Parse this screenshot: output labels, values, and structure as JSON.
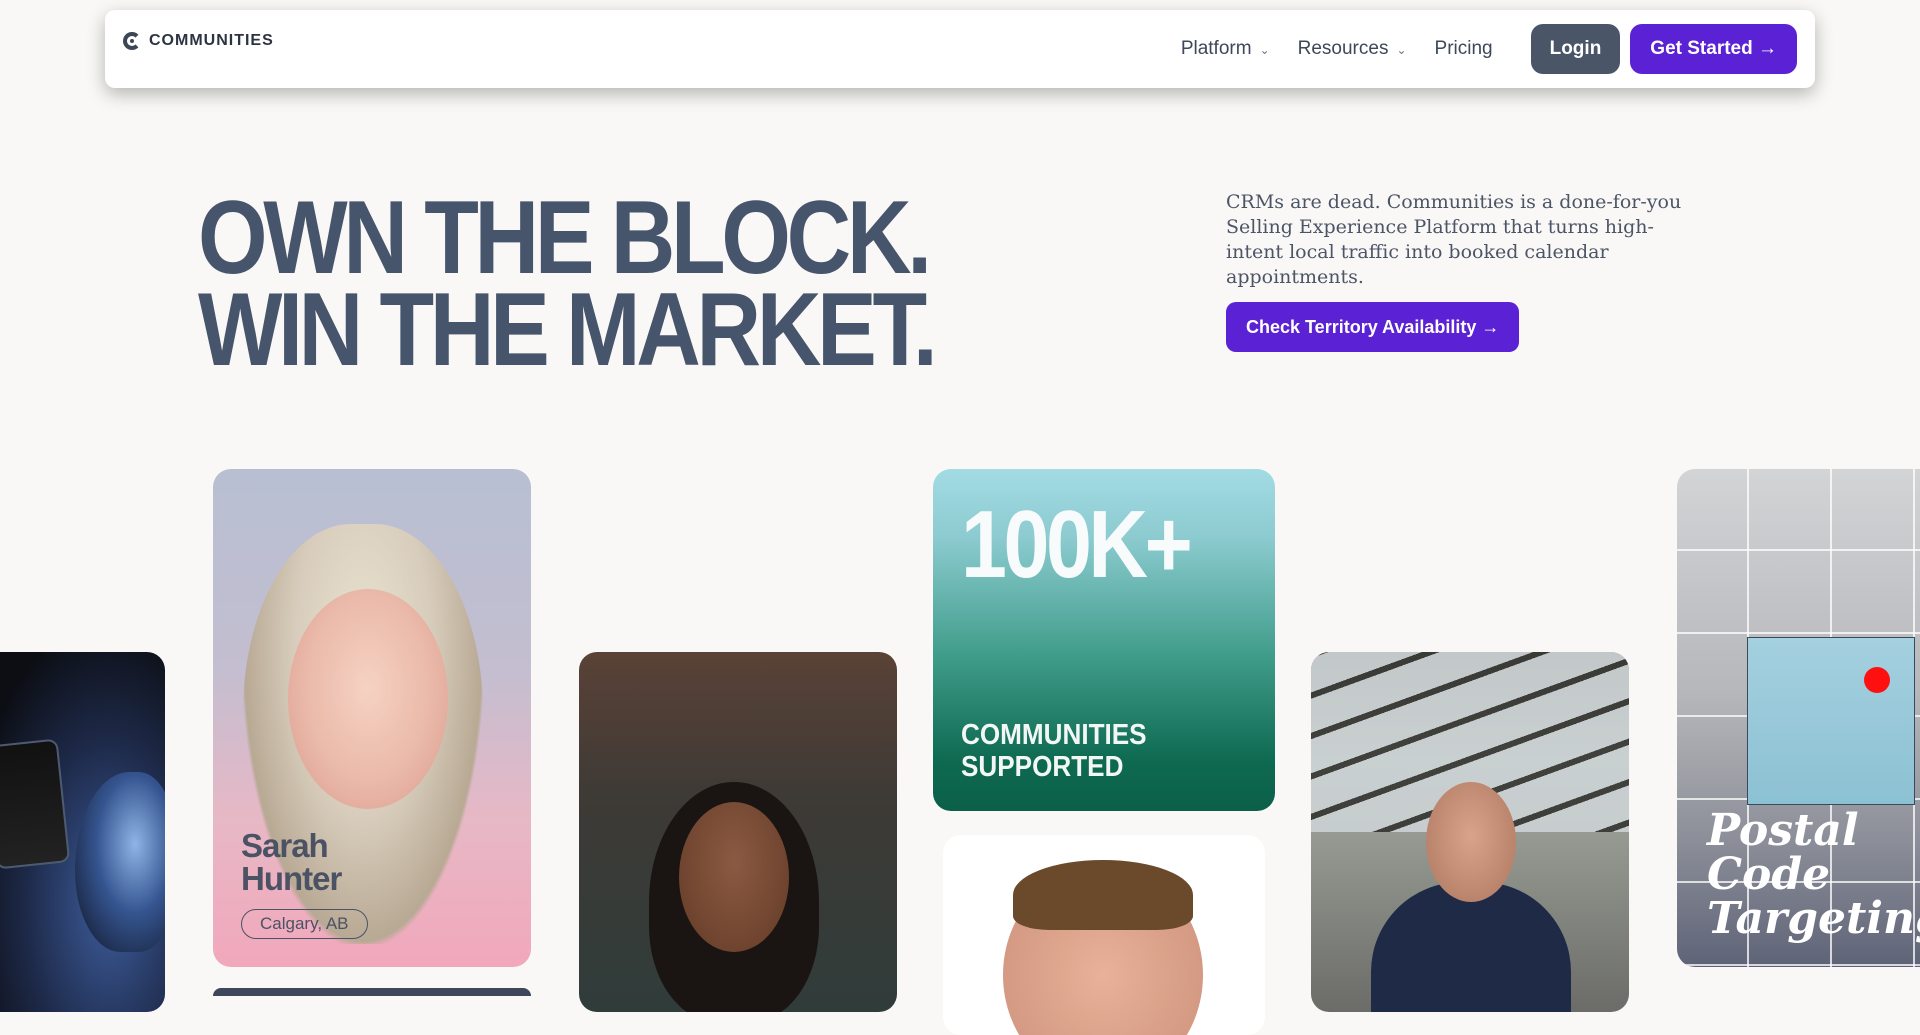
{
  "brand": {
    "name": "COMMUNITIES"
  },
  "nav": {
    "items": [
      {
        "label": "Platform",
        "has_dropdown": true
      },
      {
        "label": "Resources",
        "has_dropdown": true
      },
      {
        "label": "Pricing",
        "has_dropdown": false
      }
    ],
    "login_label": "Login",
    "get_started_label": "Get Started →"
  },
  "hero": {
    "title_line1": "OWN THE BLOCK.",
    "title_line2": "WIN THE MARKET.",
    "description": "CRMs are dead. Communities is a done-for-you Selling Experience Platform that turns high-intent local traffic into booked calendar appointments.",
    "cta_label": "Check Territory Availability →"
  },
  "cards": {
    "profile": {
      "first_name": "Sarah",
      "last_name": "Hunter",
      "location": "Calgary, AB"
    },
    "stat": {
      "value": "100K+",
      "label_line1": "COMMUNITIES",
      "label_line2": "SUPPORTED"
    },
    "feature": {
      "line1": "Postal",
      "line2": "Code",
      "line3": "Targeting"
    }
  },
  "colors": {
    "accent": "#5b21d4",
    "login_bg": "#4a5668",
    "headline": "#46556b",
    "background": "#f9f8f6"
  },
  "icons": {
    "chevron": "chevron-down-icon",
    "logo": "communities-logo-icon"
  }
}
